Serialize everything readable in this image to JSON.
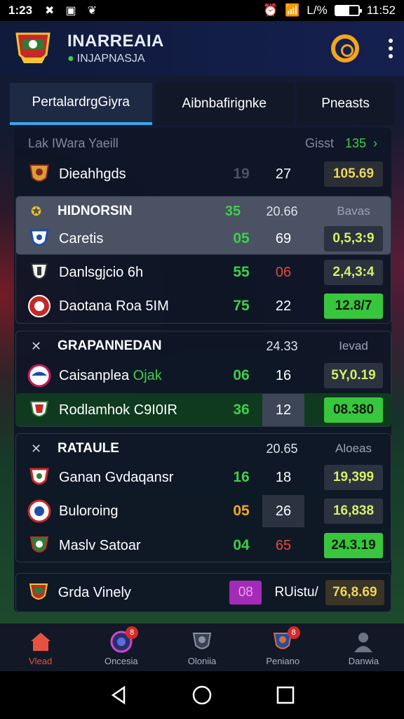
{
  "status_bar": {
    "time": "1:23",
    "battery": "L/%",
    "clock": "11:52"
  },
  "header": {
    "title": "INARREAIA",
    "subtitle": "INJAPNASJA"
  },
  "tabs": [
    {
      "label": "PertalardrgGiyra",
      "active": true
    },
    {
      "label": "Aibnbafirignke",
      "active": false
    },
    {
      "label": "Pneasts",
      "active": false
    }
  ],
  "table_head": {
    "label": "Lak IWara Yaeill",
    "col": "Gisst",
    "count": "135",
    "chevron": "›"
  },
  "rows_top": [
    {
      "name": "Dieahhgds",
      "v1": "19",
      "v2": "27",
      "odds": "105.69",
      "v1_color": "#4b5466",
      "odds_style": "gold"
    }
  ],
  "section1": {
    "title": "HIDNORSIN",
    "v1": "35",
    "v2": "20.66",
    "label": "Bavas",
    "rows": [
      {
        "name": "Caretis",
        "v1": "05",
        "v2": "69",
        "odds": "0,5,3:9",
        "v1_color": "#3ecf4a",
        "odds_style": "dark"
      },
      {
        "name": "Danlsgjcio 6h",
        "v1": "55",
        "v2": "06",
        "odds": "2,4,3:4",
        "v1_color": "#3ecf4a",
        "v2_color": "#e34a3a",
        "odds_style": "dark"
      },
      {
        "name": "Daotana Roa 5IM",
        "v1": "75",
        "v2": "22",
        "odds": "12.8/7",
        "v1_color": "#3ecf4a",
        "odds_style": "green"
      }
    ]
  },
  "section2": {
    "title": "GRAPANNEDAN",
    "v2": "24.33",
    "label": "Ievad",
    "rows": [
      {
        "name": "Caisanplea",
        "tag": "Ojak",
        "v1": "06",
        "v2": "16",
        "odds": "5Y,0.19",
        "v1_color": "#3ecf4a",
        "odds_style": "dark"
      },
      {
        "name": "Rodlamhok C9I0IR",
        "v1": "36",
        "v2": "12",
        "odds": "08.380",
        "v1_color": "#3ecf4a",
        "odds_style": "green"
      }
    ]
  },
  "section3": {
    "title": "RATAULE",
    "v2": "20.65",
    "label": "Aloeas",
    "rows": [
      {
        "name": "Ganan Gvdaqansr",
        "v1": "16",
        "v2": "18",
        "odds": "19,399",
        "v1_color": "#3ecf4a",
        "odds_style": "dark"
      },
      {
        "name": "Buloroing",
        "v1": "05",
        "v2": "26",
        "odds": "16,838",
        "v1_color": "#f0a91d",
        "odds_style": "dark"
      },
      {
        "name": "Maslv Satoar",
        "v1": "04",
        "v2": "65",
        "odds": "24.3.19",
        "v1_color": "#3ecf4a",
        "v2_color": "#e34a3a",
        "odds_style": "green"
      }
    ]
  },
  "footer_row": {
    "name": "Grda Vinely",
    "pill": "08",
    "extra": "RUistu/",
    "odds": "76,8.69"
  },
  "bottom_nav": [
    {
      "label": "Vlead",
      "icon": "home-icon",
      "active": true
    },
    {
      "label": "Oncesia",
      "icon": "ball-icon",
      "badge": "8"
    },
    {
      "label": "Oloniia",
      "icon": "team-icon"
    },
    {
      "label": "Peniano",
      "icon": "shield-icon",
      "badge": "8"
    },
    {
      "label": "Danwia",
      "icon": "profile-icon"
    }
  ]
}
